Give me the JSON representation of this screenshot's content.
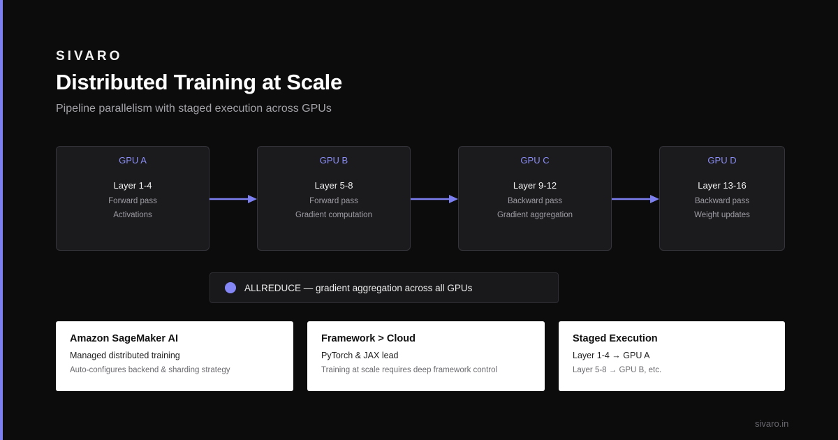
{
  "brand": "SIVARO",
  "title": "Distributed Training at Scale",
  "subtitle": "Pipeline parallelism with staged execution across GPUs",
  "gpus": [
    {
      "name": "GPU A",
      "layers": "Layer 1-4",
      "line1": "Forward pass",
      "line2": "Activations"
    },
    {
      "name": "GPU B",
      "layers": "Layer 5-8",
      "line1": "Forward pass",
      "line2": "Gradient computation"
    },
    {
      "name": "GPU C",
      "layers": "Layer 9-12",
      "line1": "Backward pass",
      "line2": "Gradient aggregation"
    },
    {
      "name": "GPU D",
      "layers": "Layer 13-16",
      "line1": "Backward pass",
      "line2": "Weight updates"
    }
  ],
  "allreduce": {
    "text": "ALLREDUCE — gradient aggregation across all GPUs"
  },
  "cards": [
    {
      "title": "Amazon SageMaker AI",
      "line": "Managed distributed training",
      "note": "Auto-configures backend & sharding strategy"
    },
    {
      "title": "Framework > Cloud",
      "line": "PyTorch & JAX lead",
      "note": "Training at scale requires deep framework control"
    },
    {
      "title": "Staged Execution",
      "line": "Layer 1-4 → GPU A",
      "note": "Layer 5-8 → GPU B, etc."
    }
  ],
  "footer": "sivaro.in",
  "colors": {
    "accent": "#8386f4",
    "background": "#0c0c0d",
    "box": "#1b1b1e"
  }
}
